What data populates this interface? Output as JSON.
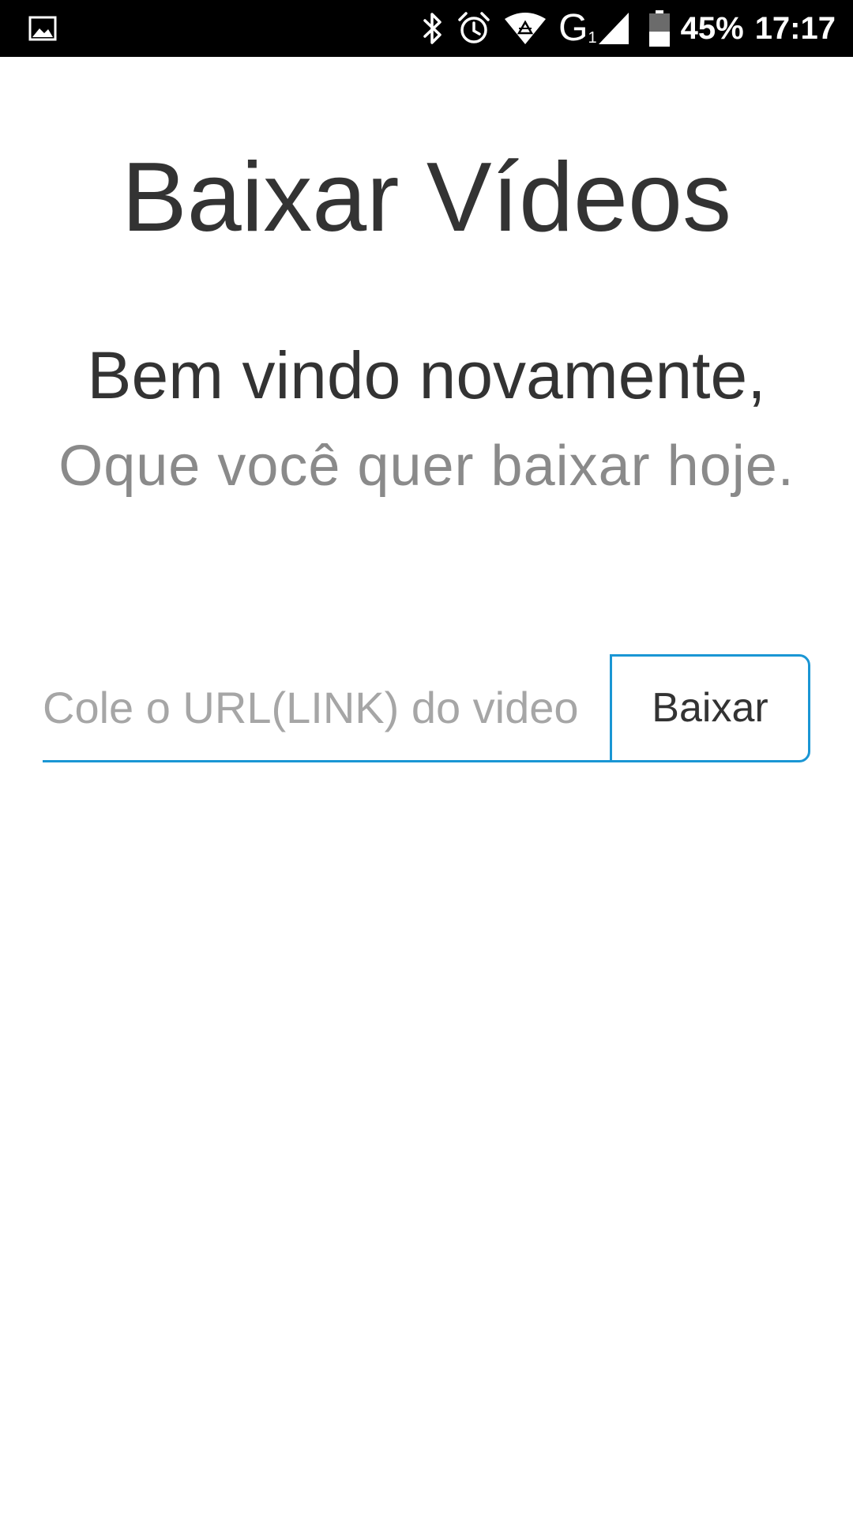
{
  "status_bar": {
    "icons": [
      "image-notification-icon",
      "bluetooth-icon",
      "alarm-icon",
      "wifi-icon",
      "network-type-icon",
      "cell-signal-icon",
      "battery-icon"
    ],
    "network_type": "G",
    "network_sub": "1",
    "battery_percent": "45%",
    "time": "17:17",
    "battery_level": 0.45
  },
  "main": {
    "title": "Baixar Vídeos",
    "welcome": "Bem vindo novamente,",
    "subtitle": "Oque você quer baixar hoje."
  },
  "url_form": {
    "placeholder": "Cole o URL(LINK) do video",
    "value": "",
    "button_label": "Baixar"
  },
  "colors": {
    "accent": "#1a96d4",
    "text_dark": "#333333",
    "text_muted": "#8a8a8a",
    "status_bar_bg": "#000000"
  }
}
